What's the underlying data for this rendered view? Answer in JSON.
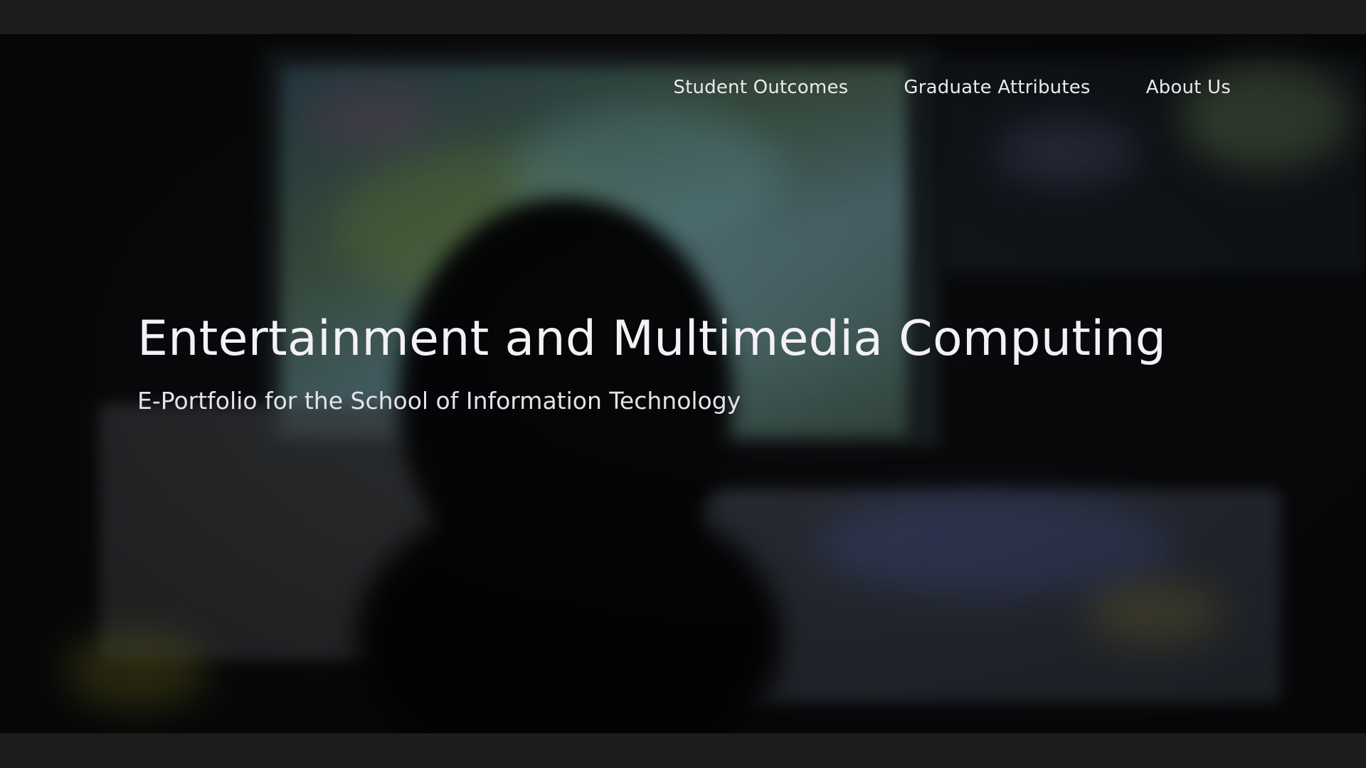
{
  "nav": {
    "items": [
      {
        "label": "Student Outcomes"
      },
      {
        "label": "Graduate Attributes"
      },
      {
        "label": "About Us"
      }
    ]
  },
  "hero": {
    "title": "Entertainment and Multimedia Computing",
    "subtitle": "E-Portfolio for the School of Information Technology"
  }
}
